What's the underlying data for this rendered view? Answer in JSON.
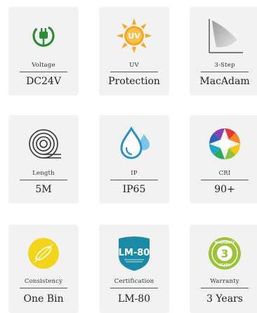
{
  "features": [
    {
      "label": "Voltage",
      "value": "DC24V",
      "icon": "plug-icon",
      "color": "#2e8b3a"
    },
    {
      "label": "UV",
      "value": "Protection",
      "icon": "uv-sun-icon",
      "color": "#f5a623"
    },
    {
      "label": "3-Step",
      "value": "MacAdam",
      "icon": "macadam-ellipse-icon",
      "color": "#bfbfbf"
    },
    {
      "label": "Length",
      "value": "5M",
      "icon": "coil-icon",
      "color": "#333333"
    },
    {
      "label": "IP",
      "value": "IP65",
      "icon": "water-drop-icon",
      "color": "#2a8fc4"
    },
    {
      "label": "CRI",
      "value": "90+",
      "icon": "color-aperture-icon",
      "color": "#e03b3b"
    },
    {
      "label": "Consistency",
      "value": "One Bin",
      "icon": "bin-ellipse-icon",
      "color": "#f2d51a"
    },
    {
      "label": "Certification",
      "value": "LM-80",
      "icon": "lm80-badge-icon",
      "color": "#1b8aa6"
    },
    {
      "label": "Warranty",
      "value": "3 Years",
      "icon": "warranty-badge-icon",
      "color": "#9cc23a"
    }
  ],
  "icon_text": {
    "uv": "UV",
    "lm80": "LM-80",
    "warranty_top": "WARRANTY",
    "warranty_num": "3",
    "warranty_bottom": "YEARS"
  }
}
